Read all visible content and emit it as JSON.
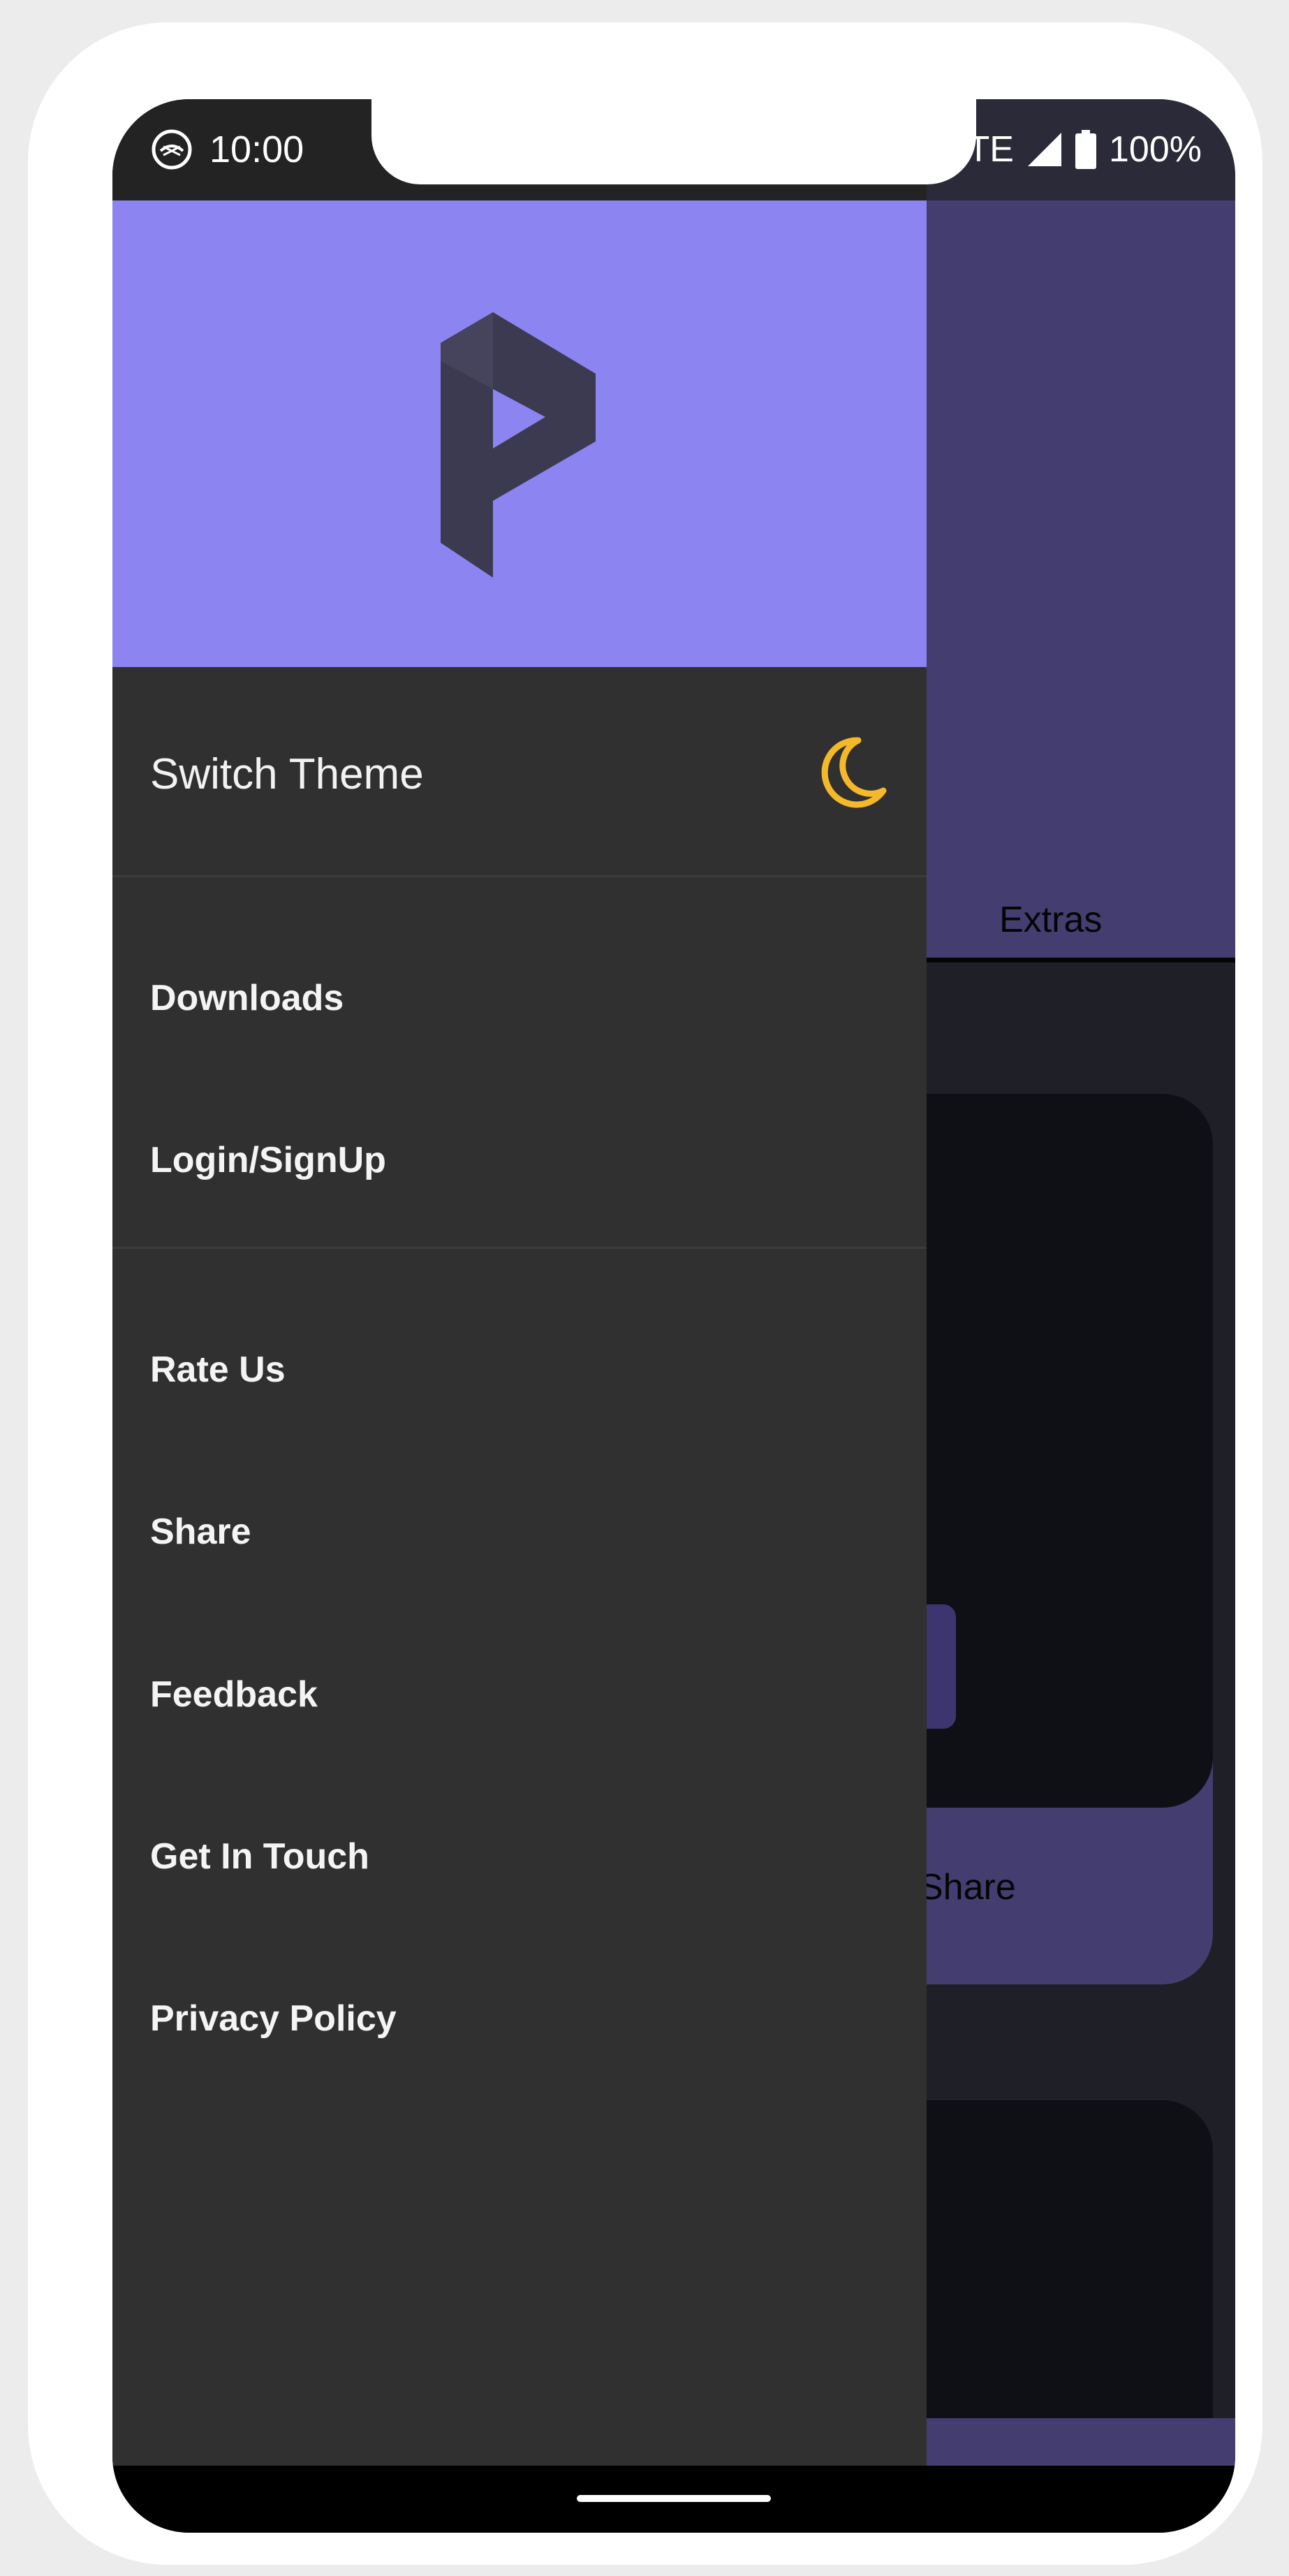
{
  "status_bar": {
    "time": "10:00",
    "network": "LTE",
    "battery": "100%"
  },
  "background": {
    "tab_label": "Extras",
    "card_action": "Share"
  },
  "drawer": {
    "theme_toggle_label": "Switch Theme",
    "menu_group_1": [
      "Downloads",
      "Login/SignUp"
    ],
    "menu_group_2": [
      "Rate Us",
      "Share",
      "Feedback",
      "Get In Touch",
      "Privacy Policy"
    ]
  },
  "colors": {
    "accent": "#8c84f0",
    "moon": "#f4b82a",
    "drawer_bg": "#303030",
    "app_primary": "#443d70"
  }
}
